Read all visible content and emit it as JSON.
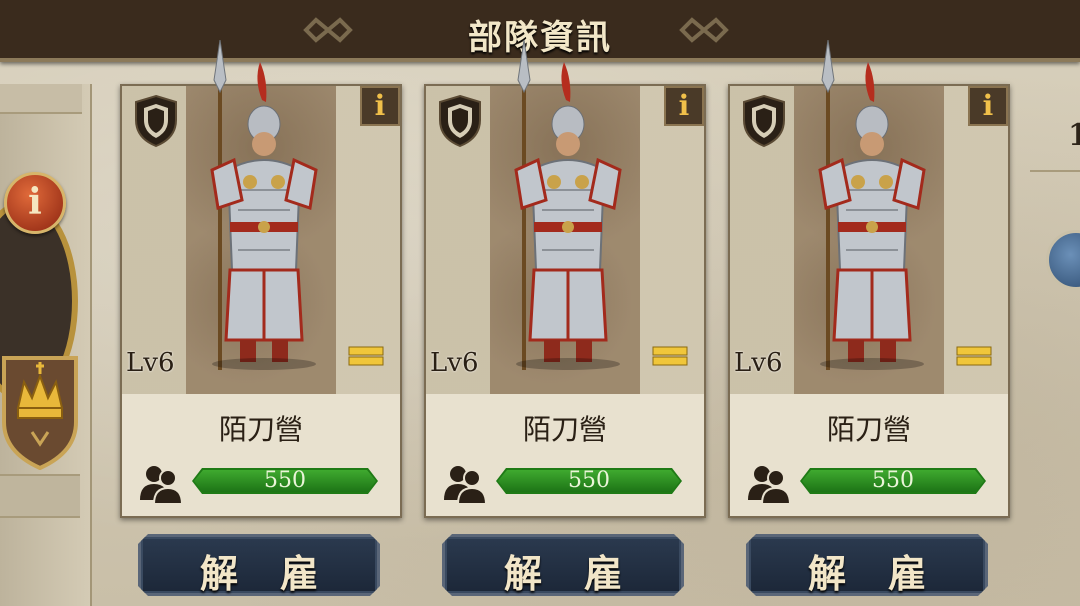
{
  "header": {
    "title": "部隊資訊"
  },
  "left_panel": {
    "info_label": "i"
  },
  "right_panel": {
    "partial_text": "1"
  },
  "units": [
    {
      "level": "Lv6",
      "name": "陌刀營",
      "troops": "550",
      "info_label": "i",
      "dismiss_label": "解雇"
    },
    {
      "level": "Lv6",
      "name": "陌刀營",
      "troops": "550",
      "info_label": "i",
      "dismiss_label": "解雇"
    },
    {
      "level": "Lv6",
      "name": "陌刀營",
      "troops": "550",
      "info_label": "i",
      "dismiss_label": "解雇"
    }
  ],
  "colors": {
    "header_bg": "#3a2b1d",
    "troop_bar": "#1f7a16",
    "button_bg": "#1c2738",
    "info_gold": "#f0c04a"
  }
}
